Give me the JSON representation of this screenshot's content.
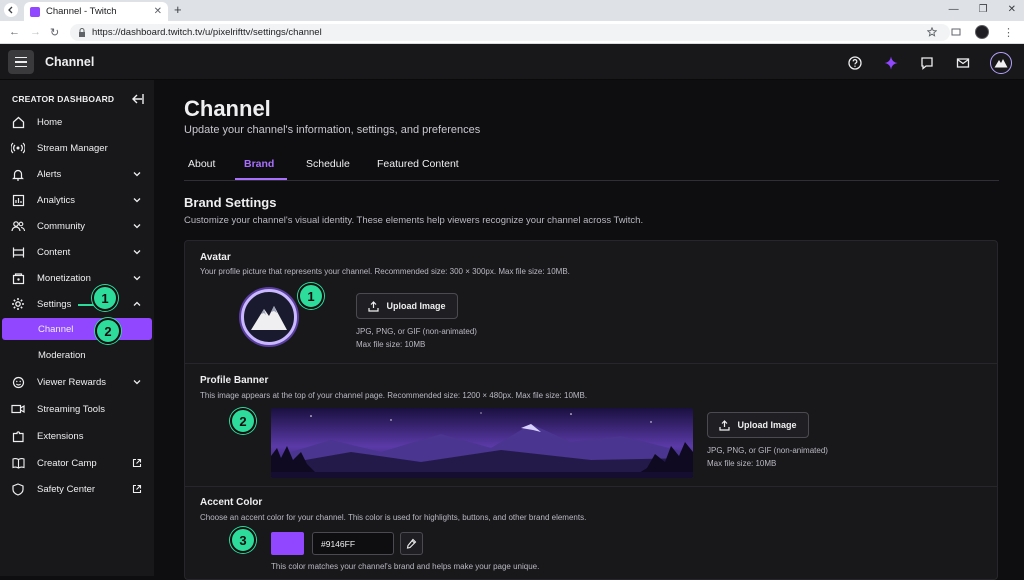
{
  "browser": {
    "tab_title": "Channel - Twitch",
    "url": "https://dashboard.twitch.tv/u/pixelrifttv/settings/channel"
  },
  "topbar": {
    "title": "Channel"
  },
  "sidebar": {
    "header": "CREATOR DASHBOARD",
    "items": [
      {
        "label": "Home",
        "icon": "home-icon"
      },
      {
        "label": "Stream Manager",
        "icon": "broadcast-icon"
      },
      {
        "label": "Alerts",
        "icon": "bell-icon"
      },
      {
        "label": "Analytics",
        "icon": "chart-icon"
      },
      {
        "label": "Community",
        "icon": "people-icon"
      },
      {
        "label": "Content",
        "icon": "content-icon"
      },
      {
        "label": "Monetization",
        "icon": "money-icon"
      },
      {
        "label": "Settings",
        "icon": "gear-icon"
      },
      {
        "label": "Viewer Rewards",
        "icon": "rewards-icon"
      },
      {
        "label": "Streaming Tools",
        "icon": "video-icon"
      },
      {
        "label": "Extensions",
        "icon": "puzzle-icon"
      },
      {
        "label": "Creator Camp",
        "icon": "book-icon"
      },
      {
        "label": "Safety Center",
        "icon": "shield-icon"
      }
    ],
    "sub_items": [
      {
        "label": "Channel"
      },
      {
        "label": "Moderation"
      }
    ]
  },
  "main": {
    "title": "Channel",
    "subtitle": "Update your channel's information, settings, and preferences",
    "tabs": [
      {
        "label": "About"
      },
      {
        "label": "Brand"
      },
      {
        "label": "Schedule"
      },
      {
        "label": "Featured Content"
      }
    ],
    "section_title": "Brand Settings",
    "section_desc": "Customize your channel's visual identity. These elements help viewers recognize your channel across Twitch.",
    "avatar": {
      "title": "Avatar",
      "desc": "Your profile picture that represents your channel. Recommended size: 300 × 300px. Max file size: 10MB.",
      "button": "Upload Image",
      "hint1": "JPG, PNG, or GIF (non-animated)",
      "hint2": "Max file size: 10MB"
    },
    "banner": {
      "title": "Profile Banner",
      "desc": "This image appears at the top of your channel page. Recommended size: 1200 × 480px. Max file size: 10MB.",
      "button": "Upload Image",
      "hint1": "JPG, PNG, or GIF (non-animated)",
      "hint2": "Max file size: 10MB"
    },
    "accent": {
      "title": "Accent Color",
      "desc": "Choose an accent color for your channel. This color is used for highlights, buttons, and other brand elements.",
      "hex": "#9146FF",
      "note": "This color matches your channel's brand and helps make your page unique."
    }
  },
  "markers": {
    "m1": "1",
    "m2": "2",
    "m3": "3"
  },
  "colors": {
    "accent": "#9146FF",
    "marker": "#2DDC9B",
    "background": "#0E0E10",
    "panel": "#18181B"
  }
}
